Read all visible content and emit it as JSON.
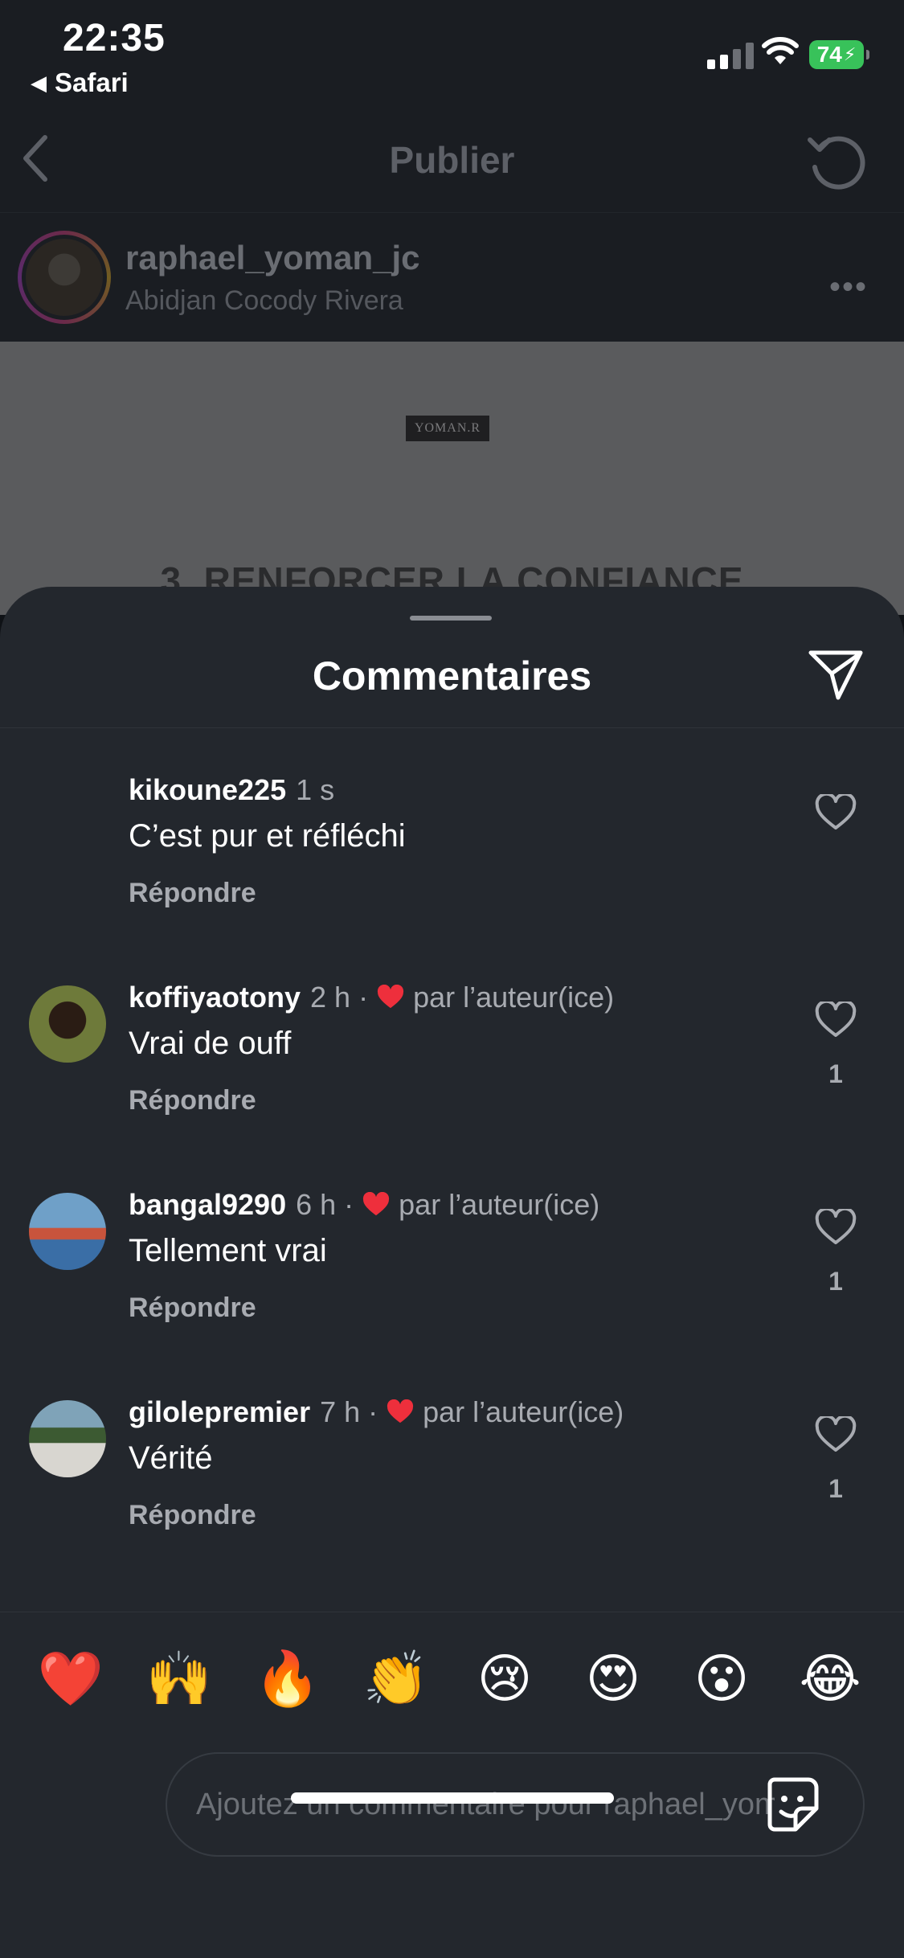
{
  "status_bar": {
    "time": "22:35",
    "back_app": "Safari",
    "battery": "74"
  },
  "background": {
    "header_title": "Publier",
    "author": {
      "username": "raphael_yoman_jc",
      "location": "Abidjan Cocody Rivera"
    },
    "post_logo_text": "YOMAN.R",
    "post_heading": "3. RENFORCER LA CONFIANCE"
  },
  "sheet": {
    "title": "Commentaires",
    "comments": [
      {
        "username": "kikoune225",
        "time": "1 s",
        "text": "C’est pur et réfléchi",
        "reply_label": "Répondre",
        "liked_by_author": false,
        "author_label": "",
        "likes": ""
      },
      {
        "username": "koffiyaotony",
        "time": "2 h",
        "text": "Vrai de ouff",
        "reply_label": "Répondre",
        "liked_by_author": true,
        "author_label": "par l’auteur(ice)",
        "likes": "1"
      },
      {
        "username": "bangal9290",
        "time": "6 h",
        "text": "Tellement vrai",
        "reply_label": "Répondre",
        "liked_by_author": true,
        "author_label": "par l’auteur(ice)",
        "likes": "1"
      },
      {
        "username": "gilolepremier",
        "time": "7 h",
        "text": "Vérité",
        "reply_label": "Répondre",
        "liked_by_author": true,
        "author_label": "par l’auteur(ice)",
        "likes": "1"
      }
    ],
    "emojis": [
      "❤️",
      "🙌",
      "🔥",
      "👏",
      "😢",
      "😍",
      "😮",
      "😂"
    ],
    "input": {
      "placeholder": "Ajoutez un commentaire pour raphael_yoman_jc…"
    }
  },
  "colors": {
    "sheet_bg": "#23272d",
    "secondary_text": "#a8abb1",
    "author_heart": "#ee2f3c",
    "battery_green": "#38c25a"
  }
}
